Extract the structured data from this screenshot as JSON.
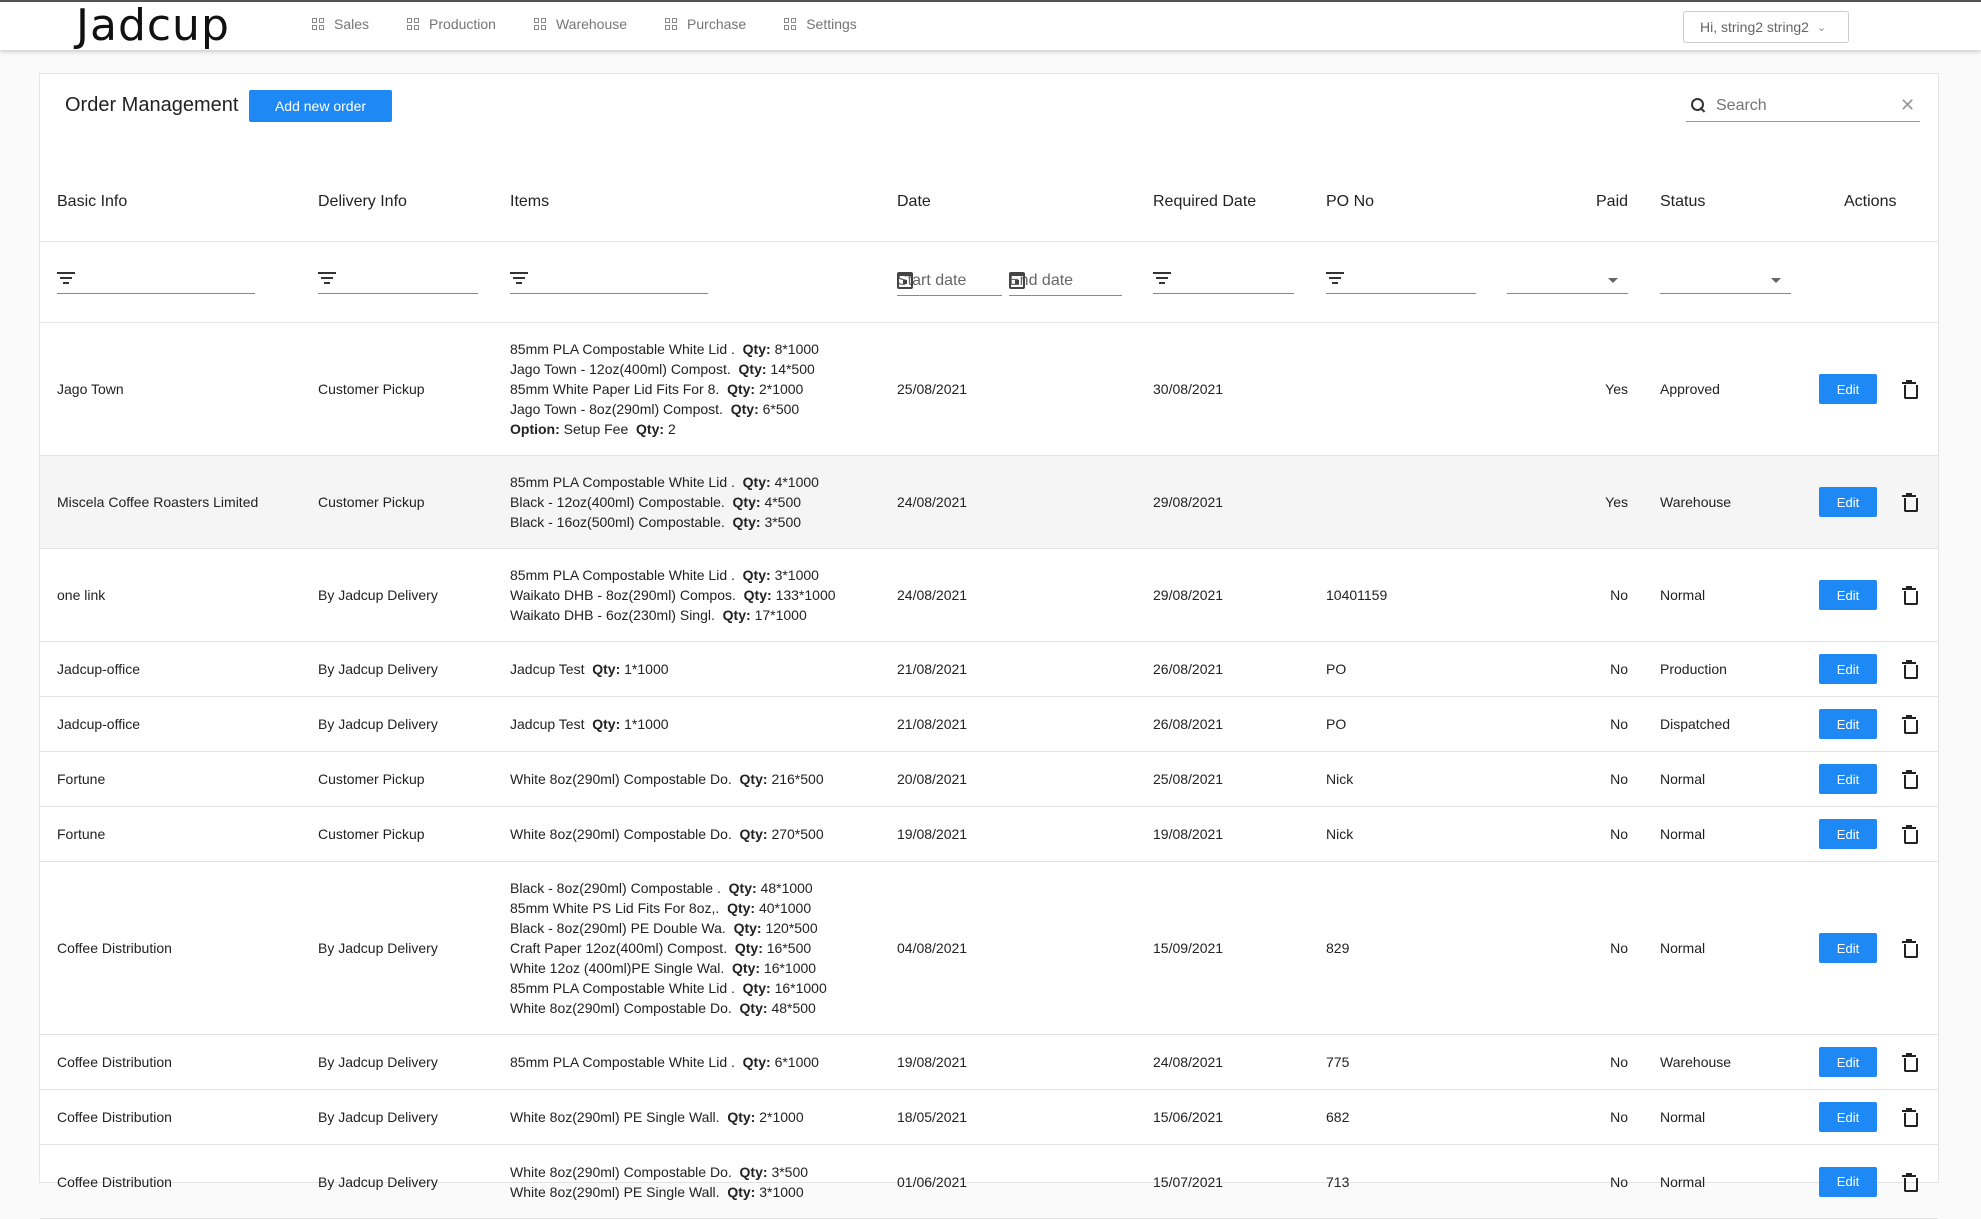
{
  "app": {
    "logo": "Jadcup"
  },
  "nav": [
    {
      "label": "Sales"
    },
    {
      "label": "Production"
    },
    {
      "label": "Warehouse"
    },
    {
      "label": "Purchase"
    },
    {
      "label": "Settings"
    }
  ],
  "user": {
    "greeting": "Hi, string2 string2"
  },
  "page": {
    "title": "Order Management",
    "add_label": "Add new order",
    "search_placeholder": "Search"
  },
  "columns": {
    "basic": "Basic Info",
    "delivery": "Delivery Info",
    "items": "Items",
    "date": "Date",
    "required": "Required Date",
    "po": "PO No",
    "paid": "Paid",
    "status": "Status",
    "actions": "Actions"
  },
  "filters": {
    "start_date": "Start date",
    "end_date": "End date"
  },
  "actions": {
    "edit_label": "Edit"
  },
  "rows": [
    {
      "basic": "Jago Town",
      "delivery": "Customer Pickup",
      "items": [
        {
          "name": "85mm PLA Compostable White Lid .",
          "key": "Qty:",
          "qty": "8*1000"
        },
        {
          "name": "Jago Town - 12oz(400ml) Compost.",
          "key": "Qty:",
          "qty": "14*500"
        },
        {
          "name": "85mm White Paper Lid Fits For 8.",
          "key": "Qty:",
          "qty": "2*1000"
        },
        {
          "name": "Jago Town - 8oz(290ml) Compost.",
          "key": "Qty:",
          "qty": "6*500"
        },
        {
          "name": "",
          "opt": "Option:",
          "optval": "Setup Fee",
          "key": "Qty:",
          "qty": "2"
        }
      ],
      "date": "25/08/2021",
      "required": "30/08/2021",
      "po": "",
      "paid": "Yes",
      "status": "Approved"
    },
    {
      "basic": "Miscela Coffee Roasters Limited",
      "delivery": "Customer Pickup",
      "items": [
        {
          "name": "85mm PLA Compostable White Lid .",
          "key": "Qty:",
          "qty": "4*1000"
        },
        {
          "name": "Black - 12oz(400ml) Compostable.",
          "key": "Qty:",
          "qty": "4*500"
        },
        {
          "name": "Black - 16oz(500ml) Compostable.",
          "key": "Qty:",
          "qty": "3*500"
        }
      ],
      "date": "24/08/2021",
      "required": "29/08/2021",
      "po": "",
      "paid": "Yes",
      "status": "Warehouse"
    },
    {
      "basic": "one link",
      "delivery": "By Jadcup Delivery",
      "items": [
        {
          "name": "85mm PLA Compostable White Lid .",
          "key": "Qty:",
          "qty": "3*1000"
        },
        {
          "name": "Waikato DHB - 8oz(290ml) Compos.",
          "key": "Qty:",
          "qty": "133*1000"
        },
        {
          "name": "Waikato DHB - 6oz(230ml) Singl.",
          "key": "Qty:",
          "qty": "17*1000"
        }
      ],
      "date": "24/08/2021",
      "required": "29/08/2021",
      "po": "10401159",
      "paid": "No",
      "status": "Normal"
    },
    {
      "basic": "Jadcup-office",
      "delivery": "By Jadcup Delivery",
      "items": [
        {
          "name": "Jadcup Test",
          "key": "Qty:",
          "qty": "1*1000"
        }
      ],
      "date": "21/08/2021",
      "required": "26/08/2021",
      "po": "PO",
      "paid": "No",
      "status": "Production"
    },
    {
      "basic": "Jadcup-office",
      "delivery": "By Jadcup Delivery",
      "items": [
        {
          "name": "Jadcup Test",
          "key": "Qty:",
          "qty": "1*1000"
        }
      ],
      "date": "21/08/2021",
      "required": "26/08/2021",
      "po": "PO",
      "paid": "No",
      "status": "Dispatched"
    },
    {
      "basic": "Fortune",
      "delivery": "Customer Pickup",
      "items": [
        {
          "name": "White 8oz(290ml) Compostable Do.",
          "key": "Qty:",
          "qty": "216*500"
        }
      ],
      "date": "20/08/2021",
      "required": "25/08/2021",
      "po": "Nick",
      "paid": "No",
      "status": "Normal"
    },
    {
      "basic": "Fortune",
      "delivery": "Customer Pickup",
      "items": [
        {
          "name": "White 8oz(290ml) Compostable Do.",
          "key": "Qty:",
          "qty": "270*500"
        }
      ],
      "date": "19/08/2021",
      "required": "19/08/2021",
      "po": "Nick",
      "paid": "No",
      "status": "Normal"
    },
    {
      "basic": "Coffee  Distribution",
      "delivery": "By Jadcup Delivery",
      "items": [
        {
          "name": "Black - 8oz(290ml) Compostable .",
          "key": "Qty:",
          "qty": "48*1000"
        },
        {
          "name": "85mm White PS Lid Fits For 8oz,.",
          "key": "Qty:",
          "qty": "40*1000"
        },
        {
          "name": "Black - 8oz(290ml) PE Double Wa.",
          "key": "Qty:",
          "qty": "120*500"
        },
        {
          "name": "Craft Paper 12oz(400ml) Compost.",
          "key": "Qty:",
          "qty": "16*500"
        },
        {
          "name": "White 12oz (400ml)PE Single Wal.",
          "key": "Qty:",
          "qty": "16*1000"
        },
        {
          "name": "85mm PLA Compostable White Lid .",
          "key": "Qty:",
          "qty": "16*1000"
        },
        {
          "name": "White 8oz(290ml) Compostable Do.",
          "key": "Qty:",
          "qty": "48*500"
        }
      ],
      "date": "04/08/2021",
      "required": "15/09/2021",
      "po": "829",
      "paid": "No",
      "status": "Normal"
    },
    {
      "basic": "Coffee  Distribution",
      "delivery": "By Jadcup Delivery",
      "items": [
        {
          "name": "85mm PLA Compostable White Lid .",
          "key": "Qty:",
          "qty": "6*1000"
        }
      ],
      "date": "19/08/2021",
      "required": "24/08/2021",
      "po": "775",
      "paid": "No",
      "status": "Warehouse"
    },
    {
      "basic": "Coffee  Distribution",
      "delivery": "By Jadcup Delivery",
      "items": [
        {
          "name": "White 8oz(290ml) PE Single Wall.",
          "key": "Qty:",
          "qty": "2*1000"
        }
      ],
      "date": "18/05/2021",
      "required": "15/06/2021",
      "po": "682",
      "paid": "No",
      "status": "Normal"
    },
    {
      "basic": "Coffee  Distribution",
      "delivery": "By Jadcup Delivery",
      "items": [
        {
          "name": "White 8oz(290ml) Compostable Do.",
          "key": "Qty:",
          "qty": "3*500"
        },
        {
          "name": "White 8oz(290ml) PE Single Wall.",
          "key": "Qty:",
          "qty": "3*1000"
        }
      ],
      "date": "01/06/2021",
      "required": "15/07/2021",
      "po": "713",
      "paid": "No",
      "status": "Normal"
    }
  ]
}
